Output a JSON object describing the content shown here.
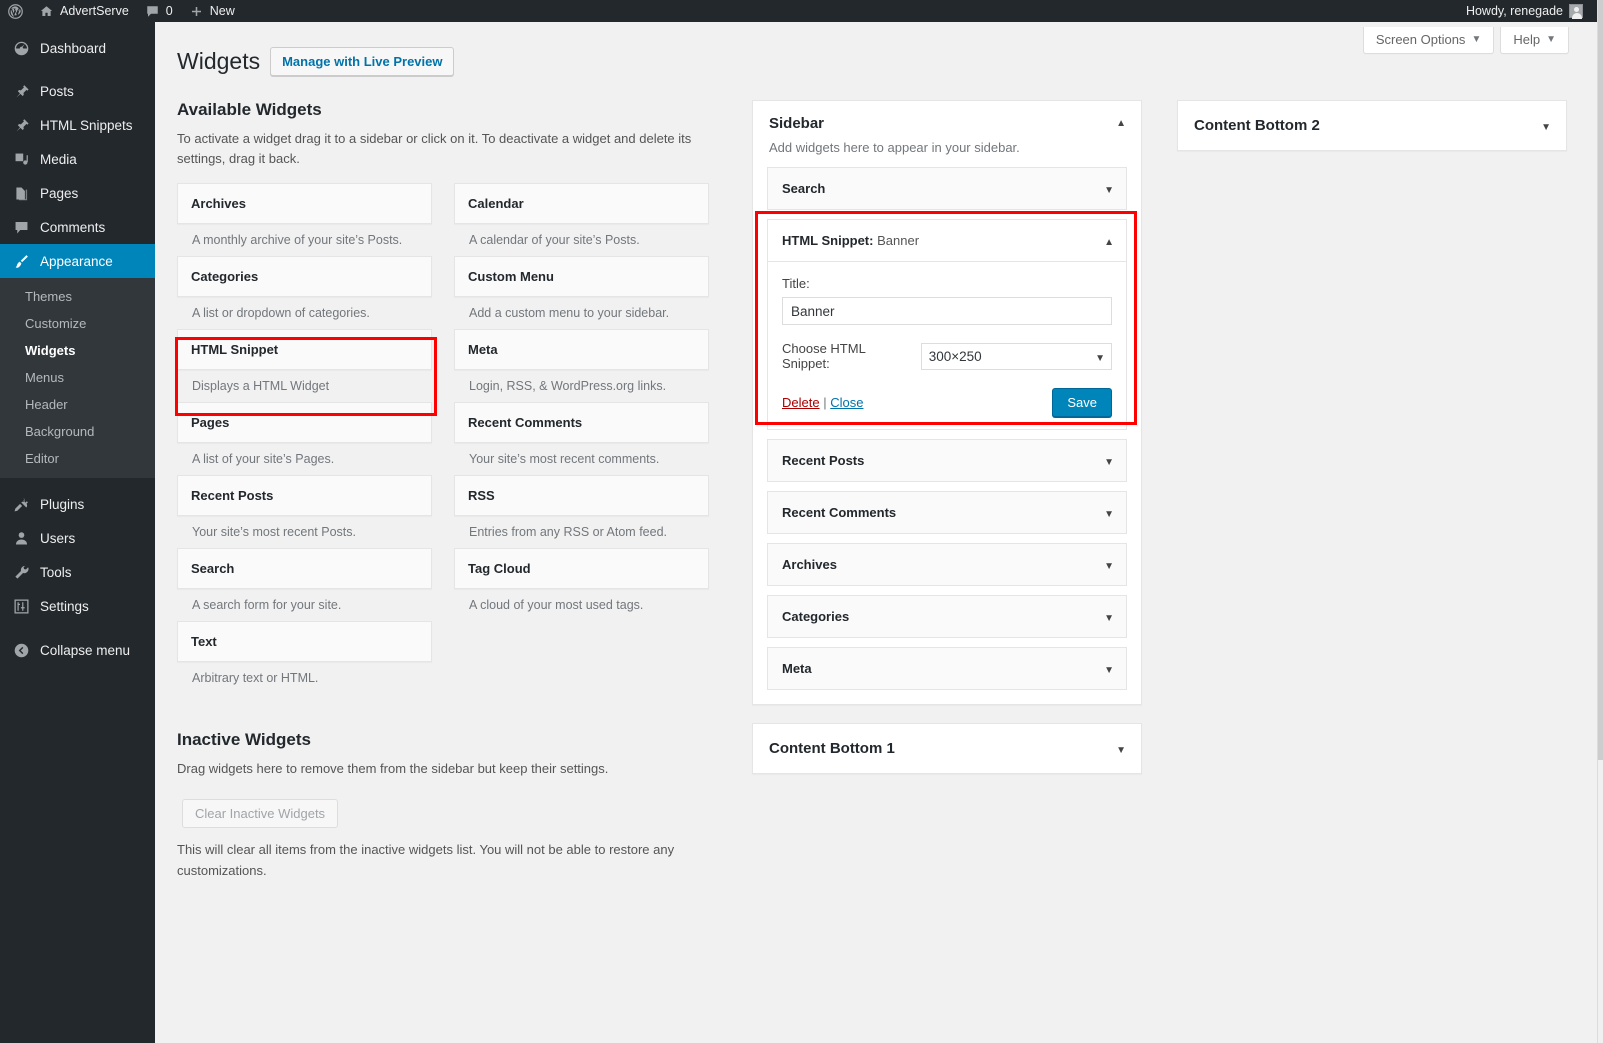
{
  "adminbar": {
    "logo_icon": "wordpress-logo-icon",
    "site_icon": "home-icon",
    "site_name": "AdvertServe",
    "comments_icon": "comment-bubble-icon",
    "comments_count": "0",
    "new_icon": "plus-icon",
    "new_label": "New",
    "howdy": "Howdy, renegade",
    "avatar_icon": "user-avatar-icon"
  },
  "menu": {
    "items": [
      {
        "label": "Dashboard",
        "icon": "dashboard-icon",
        "current": false
      },
      {
        "label": "Posts",
        "icon": "pin-icon",
        "current": false
      },
      {
        "label": "HTML Snippets",
        "icon": "pin-icon",
        "current": false
      },
      {
        "label": "Media",
        "icon": "media-icon",
        "current": false
      },
      {
        "label": "Pages",
        "icon": "pages-icon",
        "current": false
      },
      {
        "label": "Comments",
        "icon": "comment-bubble-icon",
        "current": false
      },
      {
        "label": "Appearance",
        "icon": "brush-icon",
        "current": true
      }
    ],
    "submenu": [
      {
        "label": "Themes",
        "current": false
      },
      {
        "label": "Customize",
        "current": false
      },
      {
        "label": "Widgets",
        "current": true
      },
      {
        "label": "Menus",
        "current": false
      },
      {
        "label": "Header",
        "current": false
      },
      {
        "label": "Background",
        "current": false
      },
      {
        "label": "Editor",
        "current": false
      }
    ],
    "items_after": [
      {
        "label": "Plugins",
        "icon": "plug-icon"
      },
      {
        "label": "Users",
        "icon": "user-icon"
      },
      {
        "label": "Tools",
        "icon": "wrench-icon"
      },
      {
        "label": "Settings",
        "icon": "sliders-icon"
      }
    ],
    "collapse": {
      "label": "Collapse menu",
      "icon": "collapse-arrow-icon"
    }
  },
  "screen_meta": {
    "screen_options": "Screen Options",
    "help": "Help",
    "caret": "▼"
  },
  "page": {
    "title": "Widgets",
    "live_preview_button": "Manage with Live Preview"
  },
  "available": {
    "heading": "Available Widgets",
    "description": "To activate a widget drag it to a sidebar or click on it. To deactivate a widget and delete its settings, drag it back.",
    "widgets": [
      {
        "name": "Archives",
        "desc": "A monthly archive of your site’s Posts.",
        "highlighted": false
      },
      {
        "name": "Calendar",
        "desc": "A calendar of your site’s Posts.",
        "highlighted": false
      },
      {
        "name": "Categories",
        "desc": "A list or dropdown of categories.",
        "highlighted": false
      },
      {
        "name": "Custom Menu",
        "desc": "Add a custom menu to your sidebar.",
        "highlighted": false
      },
      {
        "name": "HTML Snippet",
        "desc": "Displays a HTML Widget",
        "highlighted": true
      },
      {
        "name": "Meta",
        "desc": "Login, RSS, & WordPress.org links.",
        "highlighted": false
      },
      {
        "name": "Pages",
        "desc": "A list of your site’s Pages.",
        "highlighted": false
      },
      {
        "name": "Recent Comments",
        "desc": "Your site’s most recent comments.",
        "highlighted": false
      },
      {
        "name": "Recent Posts",
        "desc": "Your site’s most recent Posts.",
        "highlighted": false
      },
      {
        "name": "RSS",
        "desc": "Entries from any RSS or Atom feed.",
        "highlighted": false
      },
      {
        "name": "Search",
        "desc": "A search form for your site.",
        "highlighted": false
      },
      {
        "name": "Tag Cloud",
        "desc": "A cloud of your most used tags.",
        "highlighted": false
      },
      {
        "name": "Text",
        "desc": "Arbitrary text or HTML.",
        "highlighted": false
      }
    ]
  },
  "inactive": {
    "heading": "Inactive Widgets",
    "description": "Drag widgets here to remove them from the sidebar but keep their settings.",
    "clear_button": "Clear Inactive Widgets",
    "note": "This will clear all items from the inactive widgets list. You will not be able to restore any customizations."
  },
  "sidebar_panel": {
    "title": "Sidebar",
    "description": "Add widgets here to appear in your sidebar.",
    "toggle_icon": "chevron-up-icon",
    "widgets": [
      {
        "title": "Search",
        "toggle_icon": "chevron-down-icon",
        "open": false
      },
      {
        "title": "HTML Snippet:",
        "subtitle": "Banner",
        "toggle_icon": "chevron-up-icon",
        "open": true
      },
      {
        "title": "Recent Posts",
        "toggle_icon": "chevron-down-icon",
        "open": false
      },
      {
        "title": "Recent Comments",
        "toggle_icon": "chevron-down-icon",
        "open": false
      },
      {
        "title": "Archives",
        "toggle_icon": "chevron-down-icon",
        "open": false
      },
      {
        "title": "Categories",
        "toggle_icon": "chevron-down-icon",
        "open": false
      },
      {
        "title": "Meta",
        "toggle_icon": "chevron-down-icon",
        "open": false
      }
    ]
  },
  "snippet_form": {
    "title_label": "Title:",
    "title_value": "Banner",
    "title_placeholder": "",
    "choose_label": "Choose HTML Snippet:",
    "choose_value": "300×250",
    "select_arrow_icon": "chevron-down-icon",
    "delete_link": "Delete",
    "separator": "|",
    "close_link": "Close",
    "save_button": "Save"
  },
  "content_bottom_1": {
    "title": "Content Bottom 1",
    "toggle_icon": "chevron-down-icon"
  },
  "content_bottom_2": {
    "title": "Content Bottom 2",
    "toggle_icon": "chevron-down-icon"
  },
  "colors": {
    "admin_dark": "#23282d",
    "submenu_dark": "#32373c",
    "accent_blue": "#0085ba",
    "link_blue": "#0073aa",
    "page_bg": "#f1f1f1",
    "highlight_red": "#ff0000"
  }
}
